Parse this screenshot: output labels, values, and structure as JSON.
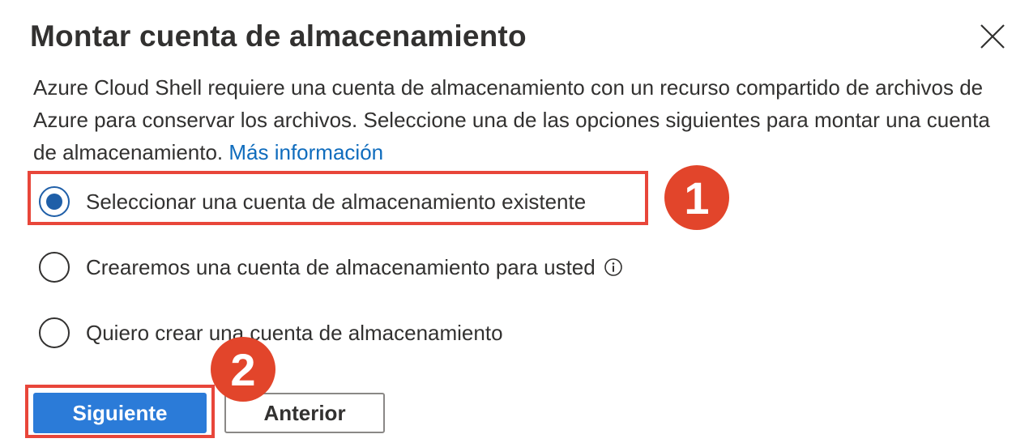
{
  "dialog": {
    "title": "Montar cuenta de almacenamiento",
    "close_icon": "close-icon",
    "description": "Azure Cloud Shell requiere una cuenta de almacenamiento con un recurso compartido de archivos de Azure para conservar los archivos. Seleccione una de las opciones siguientes para montar una cuenta de almacenamiento.",
    "learn_more_link": "Más información",
    "options": [
      {
        "label": "Seleccionar una cuenta de almacenamiento existente",
        "selected": true
      },
      {
        "label": "Crearemos una cuenta de almacenamiento para usted",
        "selected": false,
        "icon": "info-icon"
      },
      {
        "label": "Quiero crear una cuenta de almacenamiento",
        "selected": false
      }
    ],
    "buttons": {
      "next_label": "Siguiente",
      "back_label": "Anterior"
    }
  },
  "annotations": {
    "badge_1": "1",
    "badge_2": "2"
  },
  "colors": {
    "accent": "#2b7bd8",
    "link": "#0f6cbd",
    "annotation_red": "#e2452b",
    "text": "#323130"
  }
}
